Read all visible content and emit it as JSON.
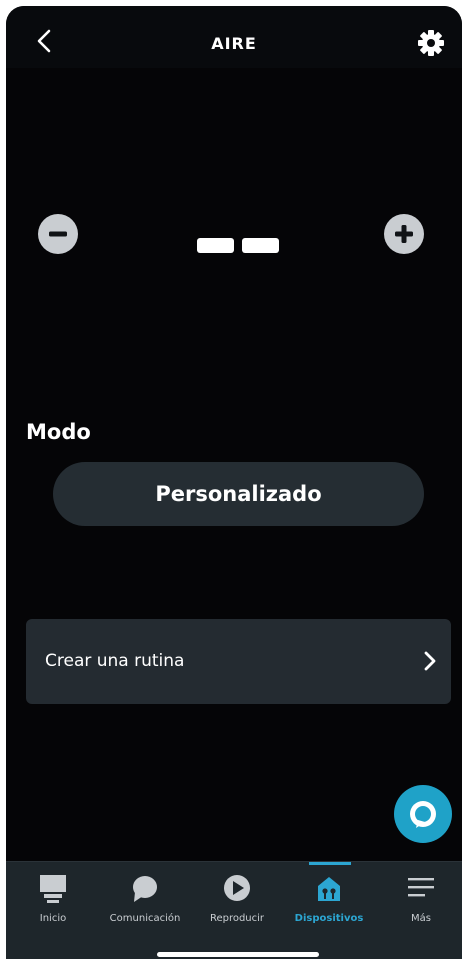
{
  "header": {
    "title": "AIRE",
    "back_icon": "chevron-left-icon",
    "settings_icon": "gear-icon"
  },
  "thermostat": {
    "decrease_icon": "minus-icon",
    "increase_icon": "plus-icon",
    "display_value": "--"
  },
  "mode": {
    "label": "Modo",
    "selected": "Personalizado"
  },
  "routine": {
    "label": "Crear una rutina",
    "chevron_icon": "chevron-right-icon"
  },
  "alexa_button": {
    "icon": "alexa-ring-icon",
    "color": "#1fa2c8"
  },
  "tabbar": {
    "active_color": "#2ca6d2",
    "tabs": [
      {
        "label": "Inicio",
        "icon": "home-icon"
      },
      {
        "label": "Comunicación",
        "icon": "chat-bubble-icon"
      },
      {
        "label": "Reproducir",
        "icon": "play-icon"
      },
      {
        "label": "Dispositivos",
        "icon": "devices-icon",
        "active": true
      },
      {
        "label": "Más",
        "icon": "menu-icon"
      }
    ]
  }
}
